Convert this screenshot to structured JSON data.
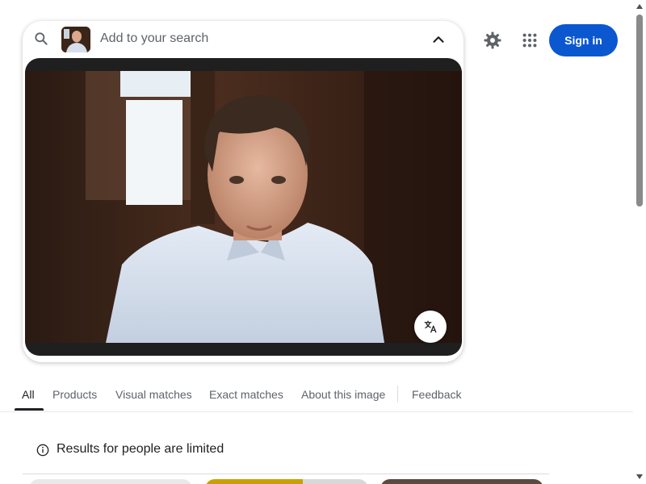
{
  "search": {
    "placeholder": "Add to your search",
    "icon": "search-icon",
    "collapse_icon": "chevron-up-icon"
  },
  "image": {
    "translate_icon": "translate-icon"
  },
  "header": {
    "settings_icon": "gear-icon",
    "apps_icon": "apps-grid-icon",
    "sign_in_label": "Sign in",
    "accent_color": "#0b57d0"
  },
  "tabs": [
    {
      "label": "All",
      "active": true
    },
    {
      "label": "Products",
      "active": false
    },
    {
      "label": "Visual matches",
      "active": false
    },
    {
      "label": "Exact matches",
      "active": false
    },
    {
      "label": "About this image",
      "active": false
    },
    {
      "label": "Feedback",
      "active": false
    }
  ],
  "notice": {
    "icon": "info-icon",
    "text": "Results for people are limited"
  }
}
